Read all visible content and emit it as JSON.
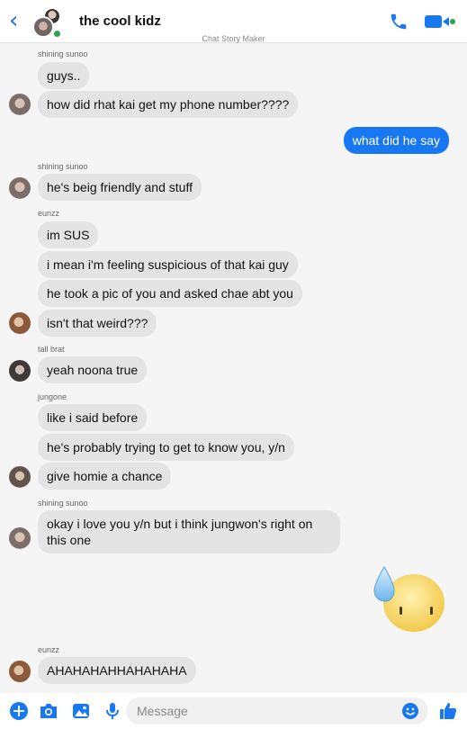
{
  "header": {
    "title": "the cool kidz",
    "watermark": "Chat Story Maker"
  },
  "messages": [
    {
      "sender": "shining sunoo",
      "text": "guys.."
    },
    {
      "text": "how did rhat kai get my phone number????"
    },
    {
      "text": "what did he say",
      "me": true
    },
    {
      "sender": "shining sunoo",
      "text": "he's beig friendly and stuff"
    },
    {
      "sender": "eunzz",
      "text": "im SUS"
    },
    {
      "text": "i mean i'm feeling suspicious of that kai guy"
    },
    {
      "text": "he took a pic of you and asked chae abt you"
    },
    {
      "text": "isn't that weird???"
    },
    {
      "sender": "tall brat",
      "text": "yeah noona true"
    },
    {
      "sender": "jungone",
      "text": "like i said before"
    },
    {
      "text": "he's probably trying to get to know you, y/n"
    },
    {
      "text": "give homie a chance"
    },
    {
      "sender": "shining sunoo",
      "text": "okay i love you y/n but i think jungwon's right on this one"
    },
    {
      "sender": "eunzz",
      "text": "AHAHAHAHHAHAHAHA"
    }
  ],
  "composer": {
    "placeholder": "Message"
  },
  "colors": {
    "accent": "#1877f2",
    "incoming_bubble": "#e4e4e4",
    "online": "#31a24c"
  }
}
